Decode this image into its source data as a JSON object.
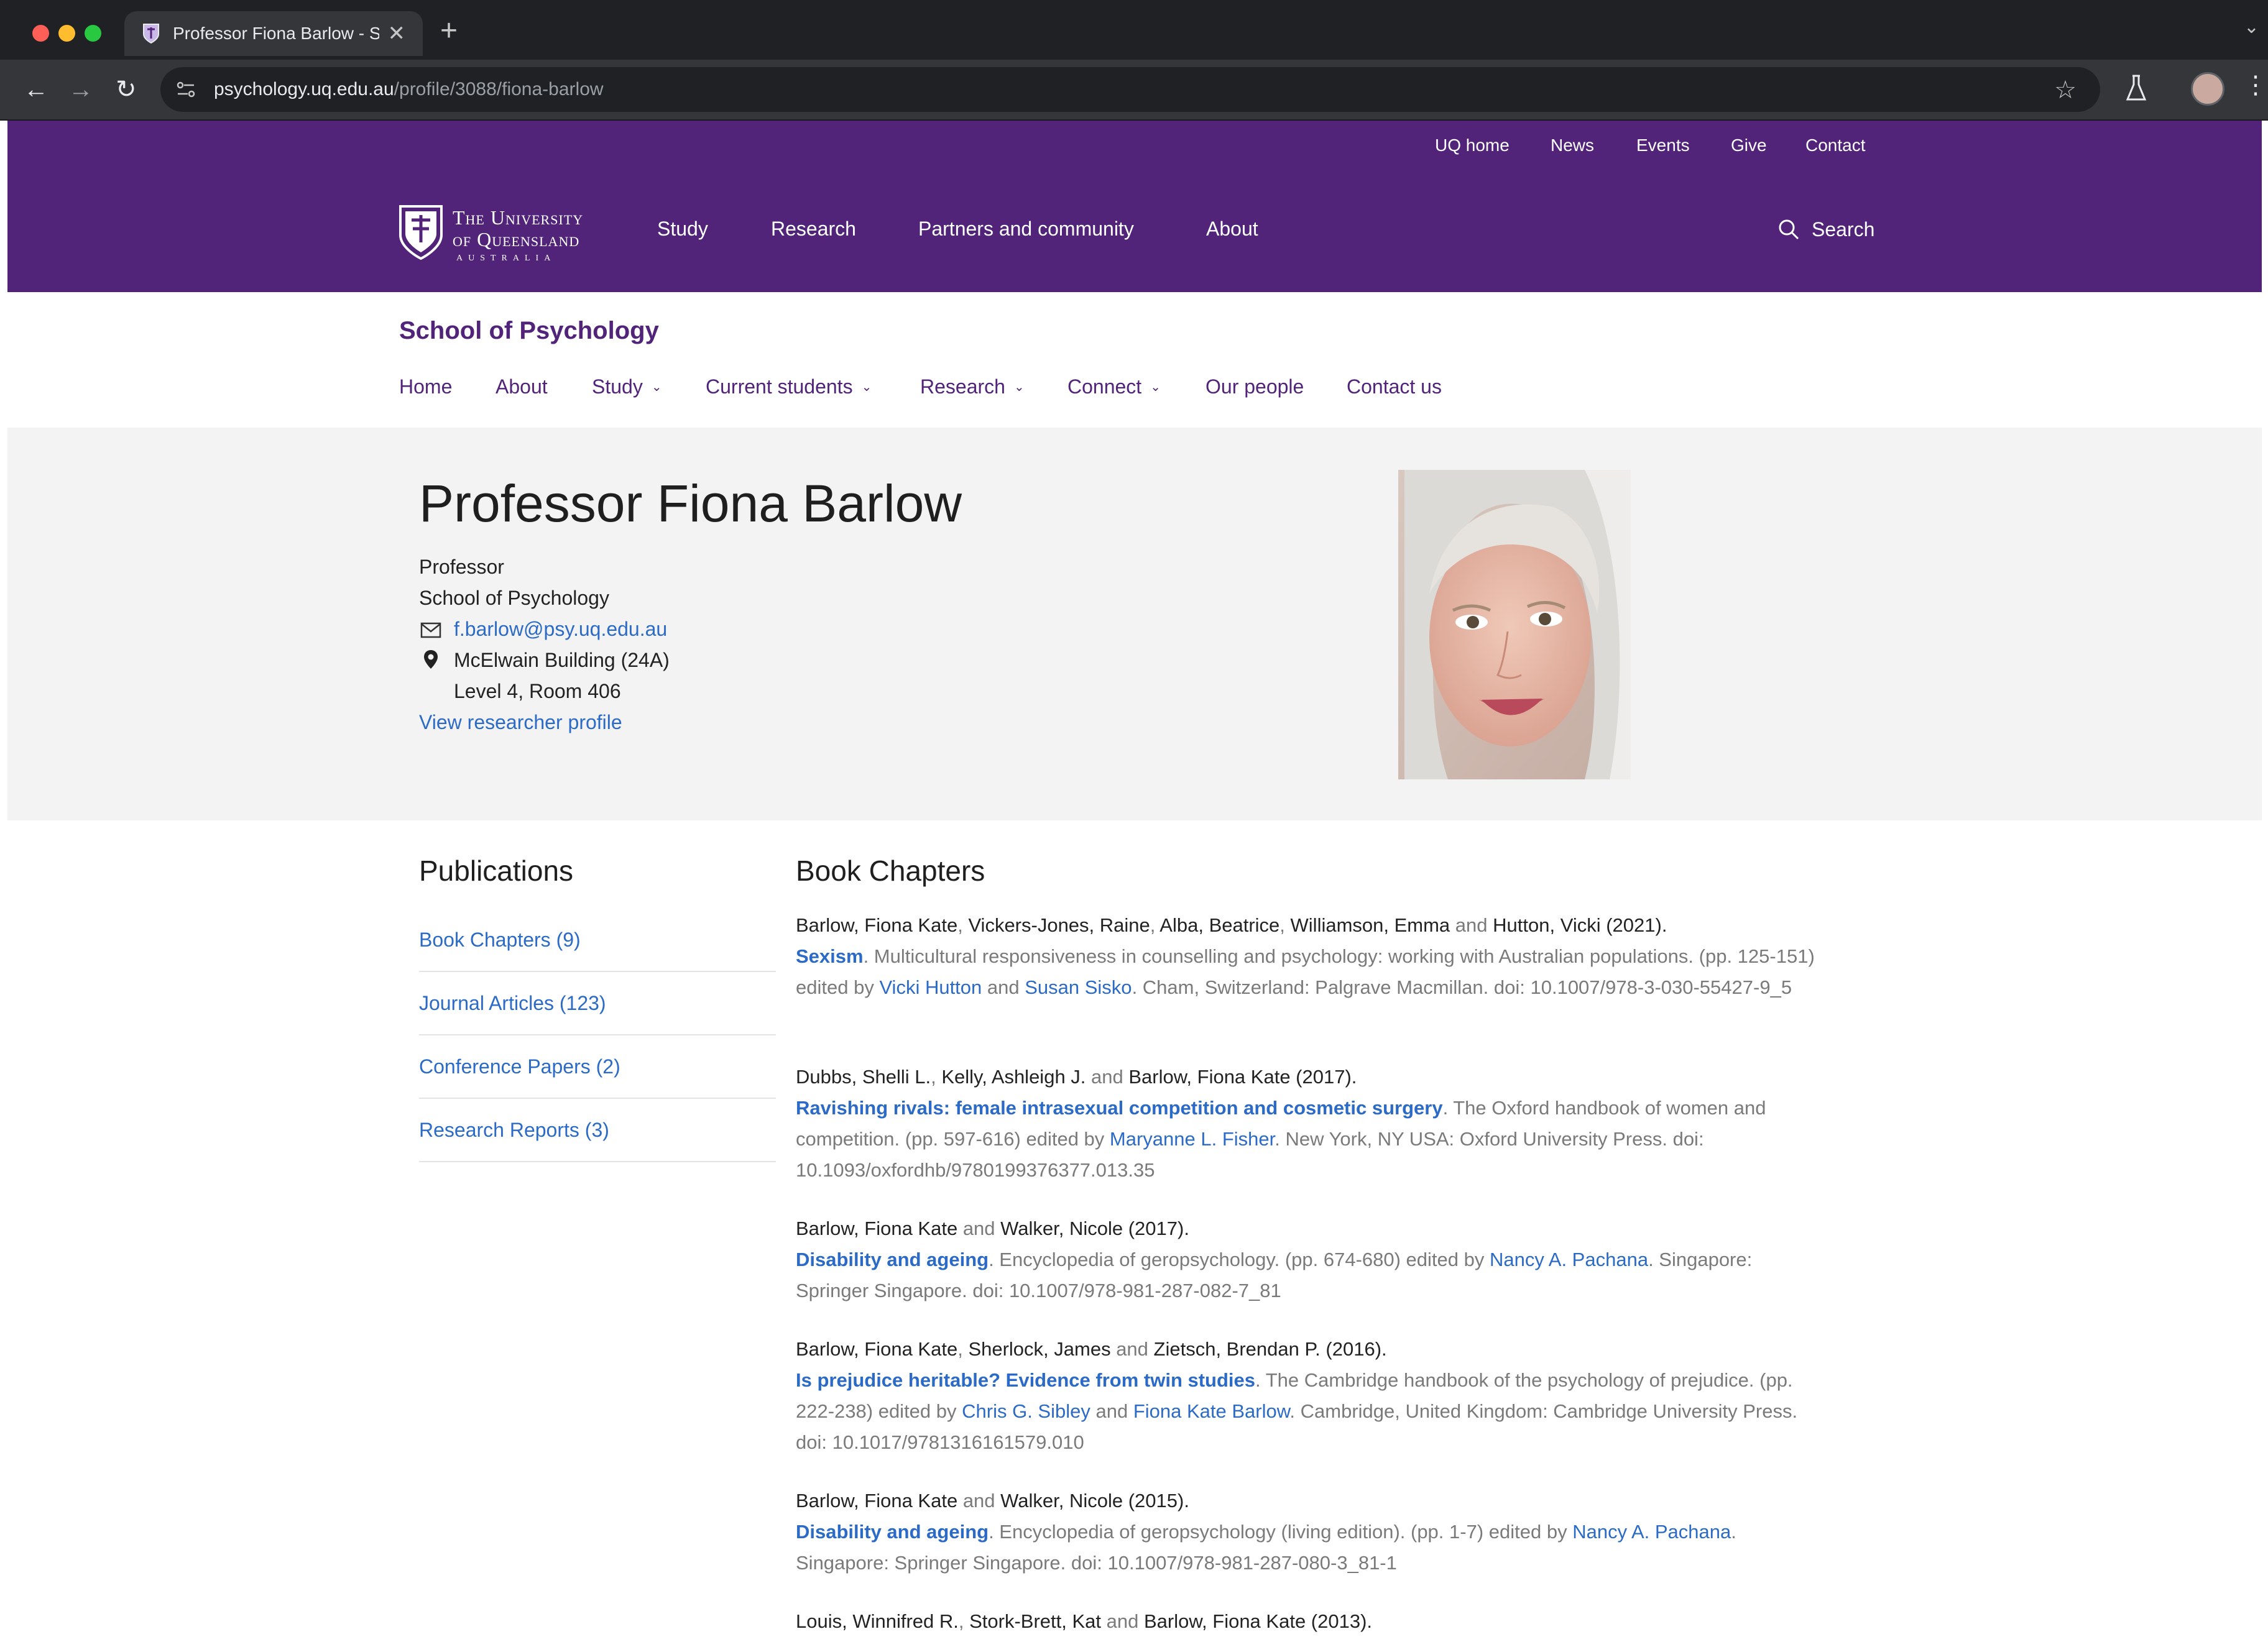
{
  "browser": {
    "tab_title": "Professor Fiona Barlow - Sch",
    "url_host": "psychology.uq.edu.au",
    "url_path": "/profile/3088/fiona-barlow"
  },
  "utility_nav": [
    "UQ home",
    "News",
    "Events",
    "Give",
    "Contact"
  ],
  "logo": {
    "line1": "The University",
    "line2": "of Queensland",
    "line3": "AUSTRALIA"
  },
  "main_nav": [
    "Study",
    "Research",
    "Partners and community",
    "About"
  ],
  "search_label": "Search",
  "school": {
    "title": "School of Psychology",
    "nav": [
      {
        "label": "Home",
        "dropdown": false
      },
      {
        "label": "About",
        "dropdown": false
      },
      {
        "label": "Study",
        "dropdown": true
      },
      {
        "label": "Current students",
        "dropdown": true
      },
      {
        "label": "Research",
        "dropdown": true
      },
      {
        "label": "Connect",
        "dropdown": true
      },
      {
        "label": "Our people",
        "dropdown": false
      },
      {
        "label": "Contact us",
        "dropdown": false
      }
    ]
  },
  "profile": {
    "name": "Professor Fiona Barlow",
    "role": "Professor",
    "school": "School of Psychology",
    "email": "f.barlow@psy.uq.edu.au",
    "building": "McElwain Building (24A)",
    "room": "Level 4, Room 406",
    "researcher_link": "View researcher profile"
  },
  "publications": {
    "heading": "Publications",
    "categories": [
      "Book Chapters (9)",
      "Journal Articles (123)",
      "Conference Papers (2)",
      "Research Reports (3)"
    ]
  },
  "book_chapters": {
    "heading": "Book Chapters",
    "entries": [
      [
        [
          "au",
          "Barlow, Fiona Kate"
        ],
        [
          "t",
          ", "
        ],
        [
          "au",
          "Vickers-Jones, Raine"
        ],
        [
          "t",
          ", "
        ],
        [
          "au",
          "Alba, Beatrice"
        ],
        [
          "t",
          ", "
        ],
        [
          "au",
          "Williamson, Emma"
        ],
        [
          "t",
          " and "
        ],
        [
          "au",
          "Hutton, Vicki"
        ],
        [
          "au",
          " (2021)."
        ],
        [
          "br",
          ""
        ],
        [
          "tt",
          "Sexism"
        ],
        [
          "t",
          ". Multicultural responsiveness in counselling and psychology: working with Australian populations. (pp. 125-151) edited by "
        ],
        [
          "lk",
          "Vicki Hutton"
        ],
        [
          "t",
          " and "
        ],
        [
          "lk",
          "Susan Sisko"
        ],
        [
          "t",
          ". Cham, Switzerland: Palgrave Macmillan. doi: 10.1007/978-3-030-55427-9_5"
        ]
      ],
      [
        [
          "au",
          "Dubbs, Shelli L."
        ],
        [
          "t",
          ", "
        ],
        [
          "au",
          "Kelly, Ashleigh J."
        ],
        [
          "t",
          " and "
        ],
        [
          "au",
          "Barlow, Fiona Kate"
        ],
        [
          "au",
          " (2017)."
        ],
        [
          "br",
          ""
        ],
        [
          "tt",
          "Ravishing rivals: female intrasexual competition and cosmetic surgery"
        ],
        [
          "t",
          ". The Oxford handbook of women and competition. (pp. 597-616) edited by "
        ],
        [
          "lk",
          "Maryanne L. Fisher"
        ],
        [
          "t",
          ". New York, NY USA: Oxford University Press. doi: 10.1093/oxfordhb/9780199376377.013.35"
        ]
      ],
      [
        [
          "au",
          "Barlow, Fiona Kate"
        ],
        [
          "t",
          " and "
        ],
        [
          "au",
          "Walker, Nicole"
        ],
        [
          "au",
          " (2017)."
        ],
        [
          "br",
          ""
        ],
        [
          "tt",
          "Disability and ageing"
        ],
        [
          "t",
          ". Encyclopedia of geropsychology. (pp. 674-680) edited by "
        ],
        [
          "lk",
          "Nancy A. Pachana"
        ],
        [
          "t",
          ". Singapore: Springer Singapore. doi: 10.1007/978-981-287-082-7_81"
        ]
      ],
      [
        [
          "au",
          "Barlow, Fiona Kate"
        ],
        [
          "t",
          ", "
        ],
        [
          "au",
          "Sherlock, James"
        ],
        [
          "t",
          " and "
        ],
        [
          "au",
          "Zietsch, Brendan P."
        ],
        [
          "au",
          " (2016)."
        ],
        [
          "br",
          ""
        ],
        [
          "tt",
          "Is prejudice heritable? Evidence from twin studies"
        ],
        [
          "t",
          ". The Cambridge handbook of the psychology of prejudice. (pp. 222-238) edited by "
        ],
        [
          "lk",
          "Chris G. Sibley"
        ],
        [
          "t",
          " and "
        ],
        [
          "lk",
          "Fiona Kate Barlow"
        ],
        [
          "t",
          ". Cambridge, United Kingdom: Cambridge University Press. doi: 10.1017/9781316161579.010"
        ]
      ],
      [
        [
          "au",
          "Barlow, Fiona Kate"
        ],
        [
          "t",
          " and "
        ],
        [
          "au",
          "Walker, Nicole"
        ],
        [
          "au",
          " (2015)."
        ],
        [
          "br",
          ""
        ],
        [
          "tt",
          "Disability and ageing"
        ],
        [
          "t",
          ". Encyclopedia of geropsychology (living edition). (pp. 1-7) edited by "
        ],
        [
          "lk",
          "Nancy A. Pachana"
        ],
        [
          "t",
          ". Singapore: Springer Singapore. doi: 10.1007/978-981-287-080-3_81-1"
        ]
      ],
      [
        [
          "au",
          "Louis, Winnifred R."
        ],
        [
          "t",
          ", "
        ],
        [
          "au",
          "Stork-Brett, Kat"
        ],
        [
          "t",
          " and "
        ],
        [
          "au",
          "Barlow, Fiona Kate"
        ],
        [
          "au",
          " (2013)."
        ]
      ]
    ]
  },
  "colors": {
    "uq_purple": "#51247a",
    "link_blue": "#2b6bc7"
  }
}
